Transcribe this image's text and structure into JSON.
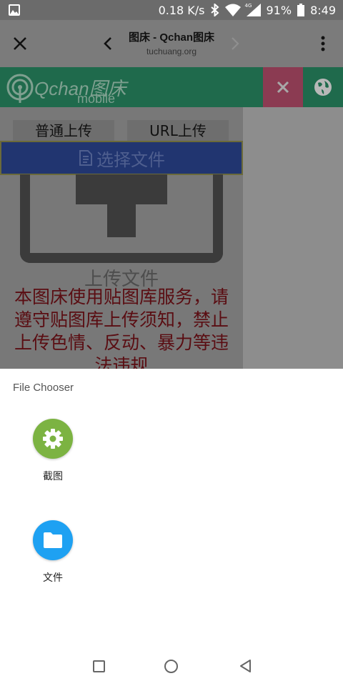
{
  "status_bar": {
    "speed": "0.18 K/s",
    "battery": "91%",
    "time": "8:49",
    "net_badge": "4G",
    "icons": [
      "image-icon",
      "bluetooth-icon",
      "wifi-icon",
      "cell-signal-icon",
      "battery-icon"
    ]
  },
  "toolbar": {
    "title": "图床 - Qchan图床",
    "url": "tuchuang.org"
  },
  "page": {
    "logo_main": "Qchan图床",
    "logo_sub": "mobile",
    "tab_normal": "普通上传",
    "tab_url": "URL上传",
    "choose_file": "选择文件",
    "upload_label": "上传文件",
    "notice": "本图床使用贴图库服务，请遵守贴图库上传须知，禁止上传色情、反动、暴力等违法违规"
  },
  "sheet": {
    "title": "File Chooser",
    "items": [
      {
        "label": "截图",
        "icon": "settings-gear-icon",
        "color": "#7cb342"
      },
      {
        "label": "文件",
        "icon": "folder-icon",
        "color": "#1ea1f2"
      }
    ]
  }
}
